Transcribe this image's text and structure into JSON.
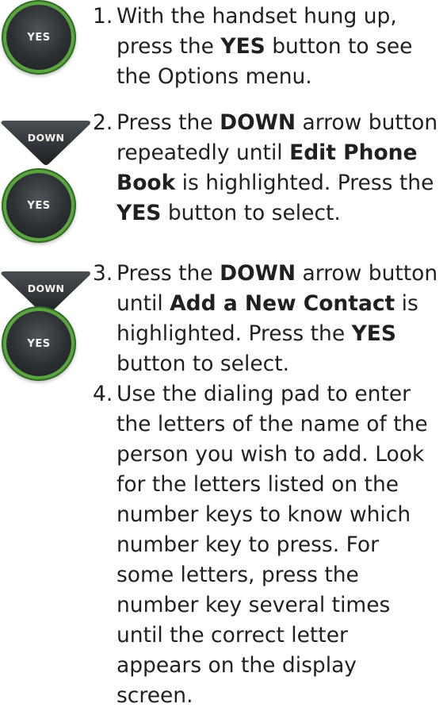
{
  "icons": {
    "yes_label": "YES",
    "down_label": "DOWN"
  },
  "steps": [
    {
      "num": "1.",
      "parts": [
        {
          "t": "With the handset hung up, press the "
        },
        {
          "b": "YES"
        },
        {
          "t": " button to see the Options menu."
        }
      ]
    },
    {
      "num": "2.",
      "parts": [
        {
          "t": "Press the "
        },
        {
          "b": "DOWN"
        },
        {
          "t": " arrow button repeatedly until "
        },
        {
          "b": "Edit Phone Book"
        },
        {
          "t": " is highlighted. Press the "
        },
        {
          "b": "YES"
        },
        {
          "t": " button to select."
        }
      ]
    },
    {
      "num": "3.",
      "parts": [
        {
          "t": "Press the "
        },
        {
          "b": "DOWN"
        },
        {
          "t": " arrow button until "
        },
        {
          "b": "Add a New Contact"
        },
        {
          "t": " is highlighted. Press the "
        },
        {
          "b": "YES"
        },
        {
          "t": " button to select."
        }
      ]
    },
    {
      "num": "4.",
      "parts": [
        {
          "t": "Use the dialing pad to enter the letters of the name of the person you wish to add. Look for the letters listed on the number keys to know which number key to press. For some letters, press the number key several times until the correct letter appears on the display screen."
        }
      ]
    }
  ],
  "colors": {
    "button_face": "#2c3033",
    "yes_ring": "#5aa53f",
    "text": "#231f20"
  }
}
